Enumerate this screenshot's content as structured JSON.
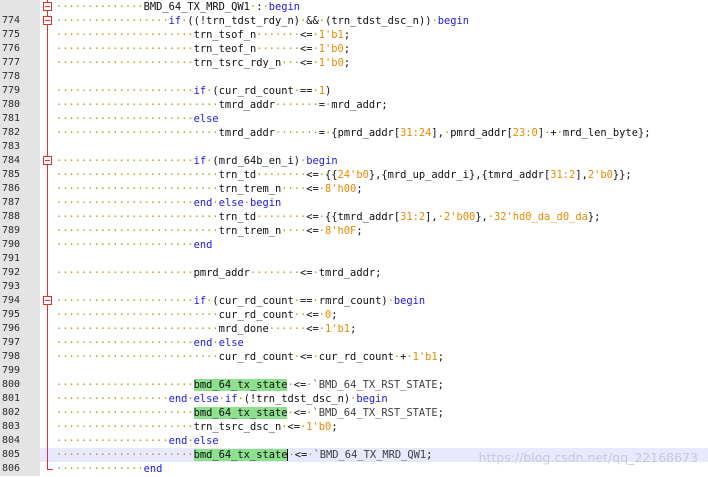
{
  "editor": {
    "lines": [
      {
        "no": "",
        "fold": "box",
        "tokens": [
          [
            "ws",
            "··············"
          ],
          [
            "id",
            "BMD_64_TX_MRD_QW1"
          ],
          [
            "ws",
            "·"
          ],
          [
            "op",
            ":"
          ],
          [
            "ws",
            "·"
          ],
          [
            "kw",
            "begin"
          ]
        ]
      },
      {
        "no": "774",
        "fold": "box",
        "tokens": [
          [
            "ws",
            "··················"
          ],
          [
            "kw",
            "if"
          ],
          [
            "ws",
            "·"
          ],
          [
            "op",
            "(("
          ],
          [
            "op",
            "!"
          ],
          [
            "id",
            "trn_tdst_rdy_n"
          ],
          [
            "op",
            ")"
          ],
          [
            "ws",
            "·"
          ],
          [
            "op",
            "&&"
          ],
          [
            "ws",
            "·"
          ],
          [
            "op",
            "("
          ],
          [
            "id",
            "trn_tdst_dsc_n"
          ],
          [
            "op",
            "))"
          ],
          [
            "ws",
            "·"
          ],
          [
            "kw",
            "begin"
          ]
        ]
      },
      {
        "no": "775",
        "fold": "rail",
        "tokens": [
          [
            "ws",
            "······················"
          ],
          [
            "id",
            "trn_tsof_n"
          ],
          [
            "ws",
            "·······"
          ],
          [
            "op",
            "<="
          ],
          [
            "ws",
            "·"
          ],
          [
            "num",
            "1'b1"
          ],
          [
            "op",
            ";"
          ]
        ]
      },
      {
        "no": "776",
        "fold": "rail",
        "tokens": [
          [
            "ws",
            "······················"
          ],
          [
            "id",
            "trn_teof_n"
          ],
          [
            "ws",
            "·······"
          ],
          [
            "op",
            "<="
          ],
          [
            "ws",
            "·"
          ],
          [
            "num",
            "1'b0"
          ],
          [
            "op",
            ";"
          ]
        ]
      },
      {
        "no": "777",
        "fold": "rail",
        "tokens": [
          [
            "ws",
            "······················"
          ],
          [
            "id",
            "trn_tsrc_rdy_n"
          ],
          [
            "ws",
            "···"
          ],
          [
            "op",
            "<="
          ],
          [
            "ws",
            "·"
          ],
          [
            "num",
            "1'b0"
          ],
          [
            "op",
            ";"
          ]
        ]
      },
      {
        "no": "778",
        "fold": "rail",
        "tokens": []
      },
      {
        "no": "779",
        "fold": "rail",
        "tokens": [
          [
            "ws",
            "······················"
          ],
          [
            "kw",
            "if"
          ],
          [
            "ws",
            "·"
          ],
          [
            "op",
            "("
          ],
          [
            "id",
            "cur_rd_count"
          ],
          [
            "ws",
            "·"
          ],
          [
            "op",
            "=="
          ],
          [
            "ws",
            "·"
          ],
          [
            "num",
            "1"
          ],
          [
            "op",
            ")"
          ]
        ]
      },
      {
        "no": "780",
        "fold": "rail",
        "tokens": [
          [
            "ws",
            "··························"
          ],
          [
            "id",
            "tmrd_addr"
          ],
          [
            "ws",
            "·······"
          ],
          [
            "op",
            "="
          ],
          [
            "ws",
            "·"
          ],
          [
            "id",
            "mrd_addr"
          ],
          [
            "op",
            ";"
          ]
        ]
      },
      {
        "no": "781",
        "fold": "rail",
        "tokens": [
          [
            "ws",
            "······················"
          ],
          [
            "kw",
            "else"
          ]
        ]
      },
      {
        "no": "782",
        "fold": "rail",
        "tokens": [
          [
            "ws",
            "··························"
          ],
          [
            "id",
            "tmrd_addr"
          ],
          [
            "ws",
            "·······"
          ],
          [
            "op",
            "="
          ],
          [
            "ws",
            "·"
          ],
          [
            "op",
            "{"
          ],
          [
            "id",
            "pmrd_addr"
          ],
          [
            "op",
            "["
          ],
          [
            "num",
            "31:24"
          ],
          [
            "op",
            "],"
          ],
          [
            "ws",
            "·"
          ],
          [
            "id",
            "pmrd_addr"
          ],
          [
            "op",
            "["
          ],
          [
            "num",
            "23:0"
          ],
          [
            "op",
            "]"
          ],
          [
            "ws",
            "·"
          ],
          [
            "op",
            "+"
          ],
          [
            "ws",
            "·"
          ],
          [
            "id",
            "mrd_len_byte"
          ],
          [
            "op",
            "};"
          ]
        ]
      },
      {
        "no": "783",
        "fold": "rail",
        "tokens": []
      },
      {
        "no": "784",
        "fold": "box",
        "tokens": [
          [
            "ws",
            "······················"
          ],
          [
            "kw",
            "if"
          ],
          [
            "ws",
            "·"
          ],
          [
            "op",
            "("
          ],
          [
            "id",
            "mrd_64b_en_i"
          ],
          [
            "op",
            ")"
          ],
          [
            "ws",
            "·"
          ],
          [
            "kw",
            "begin"
          ]
        ]
      },
      {
        "no": "785",
        "fold": "rail",
        "tokens": [
          [
            "ws",
            "··························"
          ],
          [
            "id",
            "trn_td"
          ],
          [
            "ws",
            "········"
          ],
          [
            "op",
            "<="
          ],
          [
            "ws",
            "·"
          ],
          [
            "op",
            "{{"
          ],
          [
            "num",
            "24'b0"
          ],
          [
            "op",
            "},{"
          ],
          [
            "id",
            "mrd_up_addr_i"
          ],
          [
            "op",
            "},{"
          ],
          [
            "id",
            "tmrd_addr"
          ],
          [
            "op",
            "["
          ],
          [
            "num",
            "31:2"
          ],
          [
            "op",
            "],"
          ],
          [
            "num",
            "2'b0"
          ],
          [
            "op",
            "}};"
          ]
        ]
      },
      {
        "no": "786",
        "fold": "rail",
        "tokens": [
          [
            "ws",
            "··························"
          ],
          [
            "id",
            "trn_trem_n"
          ],
          [
            "ws",
            "····"
          ],
          [
            "op",
            "<="
          ],
          [
            "ws",
            "·"
          ],
          [
            "num",
            "8'h00"
          ],
          [
            "op",
            ";"
          ]
        ]
      },
      {
        "no": "787",
        "fold": "rail",
        "tokens": [
          [
            "ws",
            "······················"
          ],
          [
            "kw",
            "end"
          ],
          [
            "ws",
            "·"
          ],
          [
            "kw",
            "else"
          ],
          [
            "ws",
            "·"
          ],
          [
            "kw",
            "begin"
          ]
        ]
      },
      {
        "no": "788",
        "fold": "rail",
        "tokens": [
          [
            "ws",
            "··························"
          ],
          [
            "id",
            "trn_td"
          ],
          [
            "ws",
            "········"
          ],
          [
            "op",
            "<="
          ],
          [
            "ws",
            "·"
          ],
          [
            "op",
            "{{"
          ],
          [
            "id",
            "tmrd_addr"
          ],
          [
            "op",
            "["
          ],
          [
            "num",
            "31:2"
          ],
          [
            "op",
            "],"
          ],
          [
            "ws",
            "·"
          ],
          [
            "num",
            "2'b00"
          ],
          [
            "op",
            "},"
          ],
          [
            "ws",
            "·"
          ],
          [
            "num",
            "32'hd0_da_d0_da"
          ],
          [
            "op",
            "};"
          ]
        ]
      },
      {
        "no": "789",
        "fold": "rail",
        "tokens": [
          [
            "ws",
            "··························"
          ],
          [
            "id",
            "trn_trem_n"
          ],
          [
            "ws",
            "····"
          ],
          [
            "op",
            "<="
          ],
          [
            "ws",
            "·"
          ],
          [
            "num",
            "8'h0F"
          ],
          [
            "op",
            ";"
          ]
        ]
      },
      {
        "no": "790",
        "fold": "rail",
        "tokens": [
          [
            "ws",
            "······················"
          ],
          [
            "kw",
            "end"
          ]
        ]
      },
      {
        "no": "791",
        "fold": "rail",
        "tokens": []
      },
      {
        "no": "792",
        "fold": "rail",
        "tokens": [
          [
            "ws",
            "······················"
          ],
          [
            "id",
            "pmrd_addr"
          ],
          [
            "ws",
            "········"
          ],
          [
            "op",
            "<="
          ],
          [
            "ws",
            "·"
          ],
          [
            "id",
            "tmrd_addr"
          ],
          [
            "op",
            ";"
          ]
        ]
      },
      {
        "no": "793",
        "fold": "rail",
        "tokens": []
      },
      {
        "no": "794",
        "fold": "box",
        "tokens": [
          [
            "ws",
            "······················"
          ],
          [
            "kw",
            "if"
          ],
          [
            "ws",
            "·"
          ],
          [
            "op",
            "("
          ],
          [
            "id",
            "cur_rd_count"
          ],
          [
            "ws",
            "·"
          ],
          [
            "op",
            "=="
          ],
          [
            "ws",
            "·"
          ],
          [
            "id",
            "rmrd_count"
          ],
          [
            "op",
            ")"
          ],
          [
            "ws",
            "·"
          ],
          [
            "kw",
            "begin"
          ]
        ]
      },
      {
        "no": "795",
        "fold": "rail",
        "tokens": [
          [
            "ws",
            "··························"
          ],
          [
            "id",
            "cur_rd_count"
          ],
          [
            "ws",
            "··"
          ],
          [
            "op",
            "<="
          ],
          [
            "ws",
            "·"
          ],
          [
            "num",
            "0"
          ],
          [
            "op",
            ";"
          ]
        ]
      },
      {
        "no": "796",
        "fold": "rail",
        "tokens": [
          [
            "ws",
            "··························"
          ],
          [
            "id",
            "mrd_done"
          ],
          [
            "ws",
            "······"
          ],
          [
            "op",
            "<="
          ],
          [
            "ws",
            "·"
          ],
          [
            "num",
            "1'b1"
          ],
          [
            "op",
            ";"
          ]
        ]
      },
      {
        "no": "797",
        "fold": "rail",
        "tokens": [
          [
            "ws",
            "······················"
          ],
          [
            "kw",
            "end"
          ],
          [
            "ws",
            "·"
          ],
          [
            "kw",
            "else"
          ]
        ]
      },
      {
        "no": "798",
        "fold": "rail",
        "tokens": [
          [
            "ws",
            "··························"
          ],
          [
            "id",
            "cur_rd_count"
          ],
          [
            "ws",
            "·"
          ],
          [
            "op",
            "<="
          ],
          [
            "ws",
            "·"
          ],
          [
            "id",
            "cur_rd_count"
          ],
          [
            "ws",
            "·"
          ],
          [
            "op",
            "+"
          ],
          [
            "ws",
            "·"
          ],
          [
            "num",
            "1'b1"
          ],
          [
            "op",
            ";"
          ]
        ]
      },
      {
        "no": "799",
        "fold": "rail",
        "tokens": []
      },
      {
        "no": "800",
        "fold": "rail",
        "tokens": [
          [
            "ws",
            "······················"
          ],
          [
            "hl",
            "bmd_64_tx_state"
          ],
          [
            "ws",
            "·"
          ],
          [
            "op",
            "<="
          ],
          [
            "ws",
            "·"
          ],
          [
            "str",
            "`BMD_64_TX_RST_STATE"
          ],
          [
            "op",
            ";"
          ]
        ]
      },
      {
        "no": "801",
        "fold": "rail",
        "tokens": [
          [
            "ws",
            "··················"
          ],
          [
            "kw",
            "end"
          ],
          [
            "ws",
            "·"
          ],
          [
            "kw",
            "else"
          ],
          [
            "ws",
            "·"
          ],
          [
            "kw",
            "if"
          ],
          [
            "ws",
            "·"
          ],
          [
            "op",
            "("
          ],
          [
            "op",
            "!"
          ],
          [
            "id",
            "trn_tdst_dsc_n"
          ],
          [
            "op",
            ")"
          ],
          [
            "ws",
            "·"
          ],
          [
            "kw",
            "begin"
          ]
        ]
      },
      {
        "no": "802",
        "fold": "rail",
        "tokens": [
          [
            "ws",
            "······················"
          ],
          [
            "hl",
            "bmd_64_tx_state"
          ],
          [
            "ws",
            "·"
          ],
          [
            "op",
            "<="
          ],
          [
            "ws",
            "·"
          ],
          [
            "str",
            "`BMD_64_TX_RST_STATE"
          ],
          [
            "op",
            ";"
          ]
        ]
      },
      {
        "no": "803",
        "fold": "rail",
        "tokens": [
          [
            "ws",
            "······················"
          ],
          [
            "id",
            "trn_tsrc_dsc_n"
          ],
          [
            "ws",
            "·"
          ],
          [
            "op",
            "<="
          ],
          [
            "ws",
            "·"
          ],
          [
            "num",
            "1'b0"
          ],
          [
            "op",
            ";"
          ]
        ]
      },
      {
        "no": "804",
        "fold": "rail",
        "tokens": [
          [
            "ws",
            "··················"
          ],
          [
            "kw",
            "end"
          ],
          [
            "ws",
            "·"
          ],
          [
            "kw",
            "else"
          ]
        ]
      },
      {
        "no": "805",
        "fold": "rail",
        "current": true,
        "tokens": [
          [
            "ws",
            "······················"
          ],
          [
            "hl",
            "bmd_64_tx_state"
          ],
          [
            "caret",
            ""
          ],
          [
            "ws",
            "·"
          ],
          [
            "op",
            "<="
          ],
          [
            "ws",
            "·"
          ],
          [
            "str",
            "`BMD_64_TX_MRD_QW1"
          ],
          [
            "op",
            ";"
          ]
        ]
      },
      {
        "no": "806",
        "fold": "tee",
        "tokens": [
          [
            "ws",
            "··············"
          ],
          [
            "kw",
            "end"
          ]
        ]
      }
    ]
  },
  "watermark": "https://blog.csdn.net/qq_22168673",
  "colors": {
    "keyword": "#1a1ae6",
    "number": "#e88a00",
    "whitespace_dots": "#b8960c",
    "highlight": "#8de08d",
    "gutter": "#e4e4e4",
    "fold_marker": "#e03030",
    "current_line": "#e8e8ff"
  }
}
